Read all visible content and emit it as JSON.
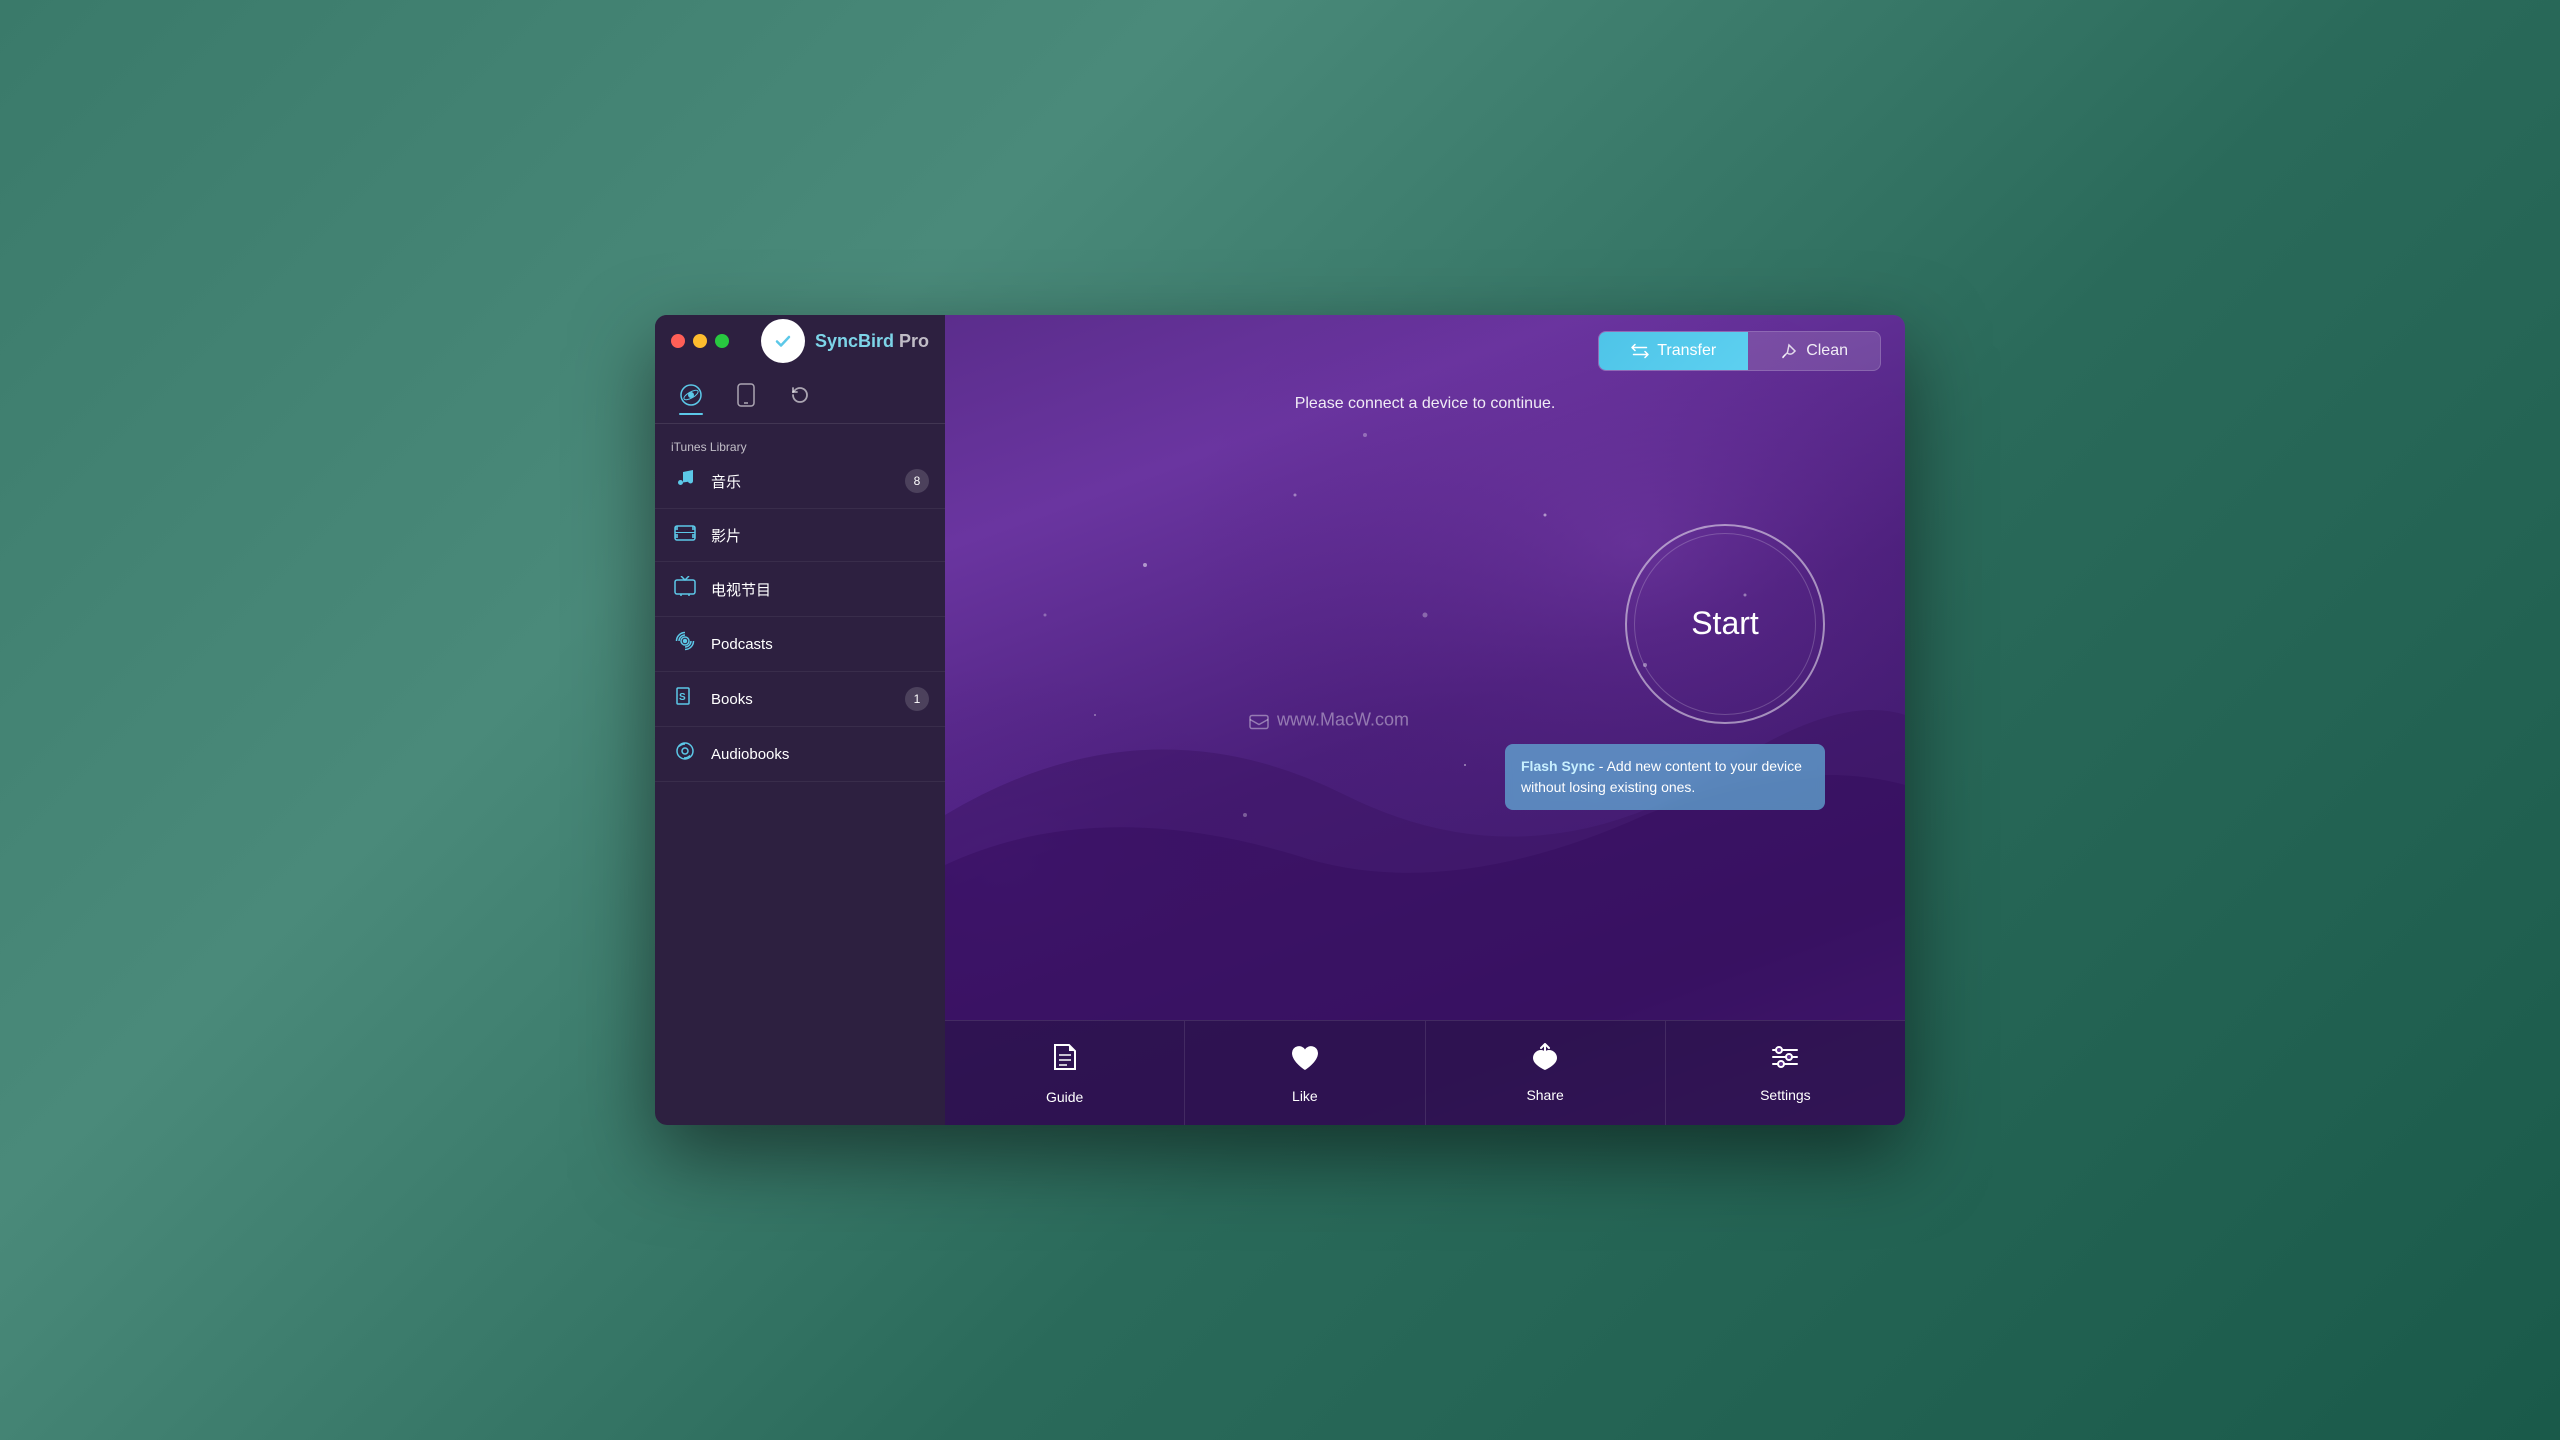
{
  "app": {
    "name": "SyncBird",
    "name_suffix": " Pro",
    "logo_icon": "✓"
  },
  "tabs": {
    "transfer": "Transfer",
    "clean": "Clean",
    "transfer_icon": "⇄",
    "clean_icon": "✦"
  },
  "header": {
    "connect_message": "Please connect a device to continue."
  },
  "sidebar": {
    "library_label": "iTunes Library",
    "tabs": [
      {
        "icon": "♫",
        "label": "music",
        "active": true
      },
      {
        "icon": "📱",
        "label": "device",
        "active": false
      },
      {
        "icon": "↺",
        "label": "refresh",
        "active": false
      }
    ],
    "items": [
      {
        "icon": "♫",
        "name": "音乐",
        "badge": "8"
      },
      {
        "icon": "🎬",
        "name": "影片",
        "badge": ""
      },
      {
        "icon": "📺",
        "name": "电视节目",
        "badge": ""
      },
      {
        "icon": "🎙",
        "name": "Podcasts",
        "badge": ""
      },
      {
        "icon": "📗",
        "name": "Books",
        "badge": "1"
      },
      {
        "icon": "🔊",
        "name": "Audiobooks",
        "badge": ""
      }
    ]
  },
  "main": {
    "start_button_label": "Start",
    "flash_sync_title": "Flash Sync",
    "flash_sync_description": " - Add new content to your device without losing existing ones.",
    "watermark": "www.MacW.com"
  },
  "bottom_bar": [
    {
      "icon": "📖",
      "label": "Guide"
    },
    {
      "icon": "♥",
      "label": "Like"
    },
    {
      "icon": "🐦",
      "label": "Share"
    },
    {
      "icon": "⚙",
      "label": "Settings"
    }
  ],
  "colors": {
    "accent_blue": "#5cc8e8",
    "sidebar_bg": "#2d2040",
    "main_bg_from": "#5b2d8c",
    "main_bg_to": "#3d1a6a"
  }
}
